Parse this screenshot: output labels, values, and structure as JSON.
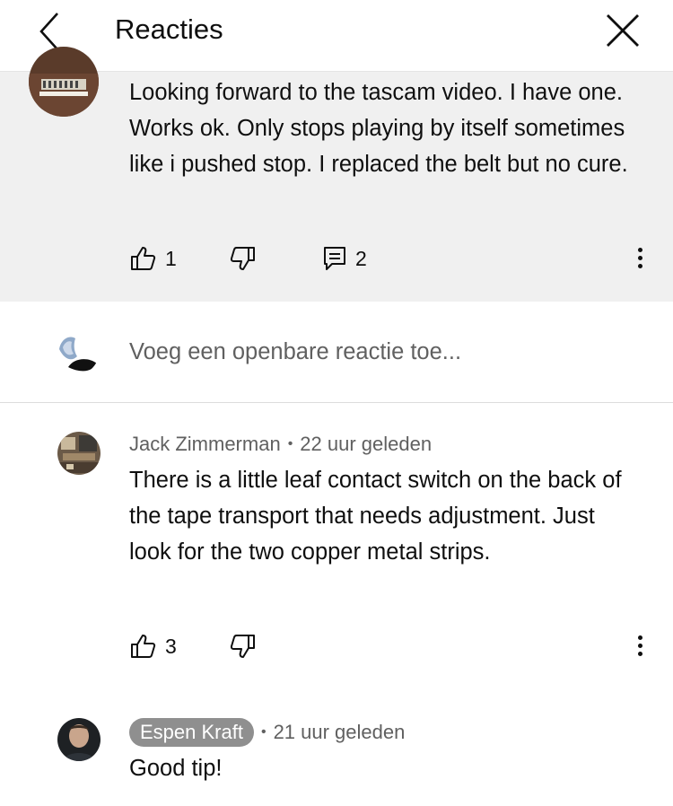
{
  "header": {
    "title": "Reacties",
    "back_icon": "chevron-left-icon",
    "close_icon": "close-icon"
  },
  "top_comment": {
    "text": "Looking forward to the tascam video. I have one. Works ok. Only stops playing by itself sometimes like i pushed stop. I replaced the belt but no cure.",
    "likes": "1",
    "replies": "2",
    "background": "#f0f0f0"
  },
  "add_comment": {
    "placeholder": "Voeg een openbare reactie toe..."
  },
  "replies": [
    {
      "author": "Jack Zimmerman",
      "time": "22 uur geleden",
      "text": "There is a little leaf contact switch on the back of the tape transport that needs adjustment. Just look for the two copper metal strips.",
      "likes": "3"
    },
    {
      "author": "Espen Kraft",
      "time": "21 uur geleden",
      "text": "Good tip!",
      "is_creator": true
    }
  ],
  "colors": {
    "text": "#0f0f0f",
    "secondary_text": "#606060",
    "creator_badge": "#8f8f8f",
    "highlight_bg": "#f0f0f0"
  }
}
